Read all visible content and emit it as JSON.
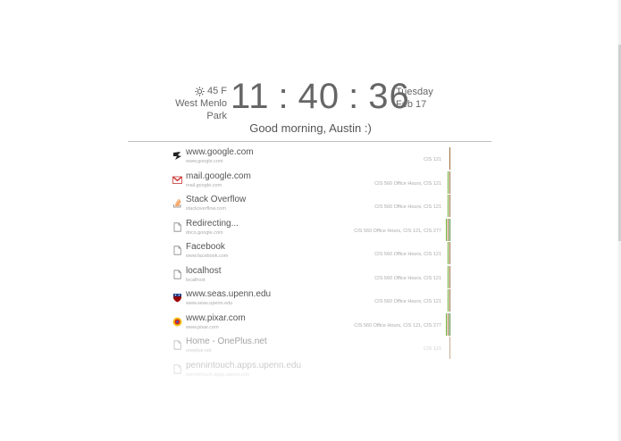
{
  "weather": {
    "temp": "45 F",
    "location": "West Menlo Park",
    "icon": "sun-icon"
  },
  "clock": {
    "hours": "11",
    "minutes": "40",
    "seconds": "36",
    "separator": ":"
  },
  "date": {
    "weekday": "Tuesday",
    "day": "Feb 17"
  },
  "greeting": "Good morning, Austin :)",
  "colors": {
    "tag_green": "#6aaa2a",
    "tag_brown": "#9b6a3a",
    "tag_darkgreen": "#3d8a2a"
  },
  "history": [
    {
      "title": "www.google.com",
      "url": "www.google.com",
      "tags": "CIS 121",
      "icon": "google-icon",
      "bars": [
        "#9b6a3a"
      ]
    },
    {
      "title": "mail.google.com",
      "url": "mail.google.com",
      "tags": "CIS 560 Office Hours, CIS 121",
      "icon": "gmail-icon",
      "bars": [
        "#6aaa2a",
        "#9b6a3a"
      ]
    },
    {
      "title": "Stack Overflow",
      "url": "stackoverflow.com",
      "tags": "CIS 560 Office Hours, CIS 121",
      "icon": "stackoverflow-icon",
      "bars": [
        "#6aaa2a",
        "#9b6a3a"
      ]
    },
    {
      "title": "Redirecting...",
      "url": "docs.google.com",
      "tags": "CIS 560 Office Hours, CIS 121, CIS 277",
      "icon": "document-icon",
      "bars": [
        "#6aaa2a",
        "#9b6a3a",
        "#3d8a2a"
      ]
    },
    {
      "title": "Facebook",
      "url": "www.facebook.com",
      "tags": "CIS 560 Office Hours, CIS 121",
      "icon": "document-icon",
      "bars": [
        "#6aaa2a",
        "#9b6a3a"
      ]
    },
    {
      "title": "localhost",
      "url": "localhost",
      "tags": "CIS 560 Office Hours, CIS 121",
      "icon": "document-icon",
      "bars": [
        "#6aaa2a",
        "#9b6a3a"
      ]
    },
    {
      "title": "www.seas.upenn.edu",
      "url": "www.seas.upenn.edu",
      "tags": "CIS 560 Office Hours, CIS 121",
      "icon": "penn-shield-icon",
      "bars": [
        "#6aaa2a",
        "#9b6a3a"
      ]
    },
    {
      "title": "www.pixar.com",
      "url": "www.pixar.com",
      "tags": "CIS 560 Office Hours, CIS 121, CIS 277",
      "icon": "pixar-icon",
      "bars": [
        "#6aaa2a",
        "#9b6a3a",
        "#3d8a2a"
      ]
    },
    {
      "title": "Home - OnePlus.net",
      "url": "oneplus.net",
      "tags": "CIS 121",
      "icon": "document-icon",
      "bars": [
        "#9b6a3a"
      ]
    },
    {
      "title": "pennintouch.apps.upenn.edu",
      "url": "pennintouch.apps.upenn.edu",
      "tags": "",
      "icon": "document-icon",
      "bars": []
    }
  ]
}
